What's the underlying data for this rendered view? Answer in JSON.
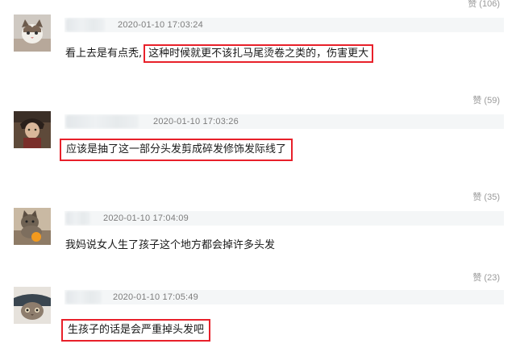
{
  "comments": [
    {
      "likes": "赞 (106)",
      "timestamp": "2020-01-10 17:03:24",
      "text_plain": "看上去是有点秃,",
      "text_highlight": "这种时候就更不该扎马尾烫卷之类的，伤害更大",
      "avatar": "cat-avatar"
    },
    {
      "likes": "赞 (59)",
      "timestamp": "2020-01-10 17:03:26",
      "text_highlight": "应该是抽了这一部分头发剪成碎发修饰发际线了",
      "avatar": "portrait-avatar"
    },
    {
      "likes": "赞 (35)",
      "timestamp": "2020-01-10 17:04:09",
      "text_plain": "我妈说女人生了孩子这个地方都会掉许多头发",
      "avatar": "cat-orange-avatar"
    },
    {
      "likes": "赞 (23)",
      "timestamp": "2020-01-10 17:05:49",
      "text_highlight": "生孩子的话是会严重掉头发吧",
      "avatar": "cat-blanket-avatar"
    }
  ],
  "colors": {
    "highlight": "#e8202a",
    "timestamp": "#7c7c7c",
    "likes": "#9a9a9a"
  }
}
